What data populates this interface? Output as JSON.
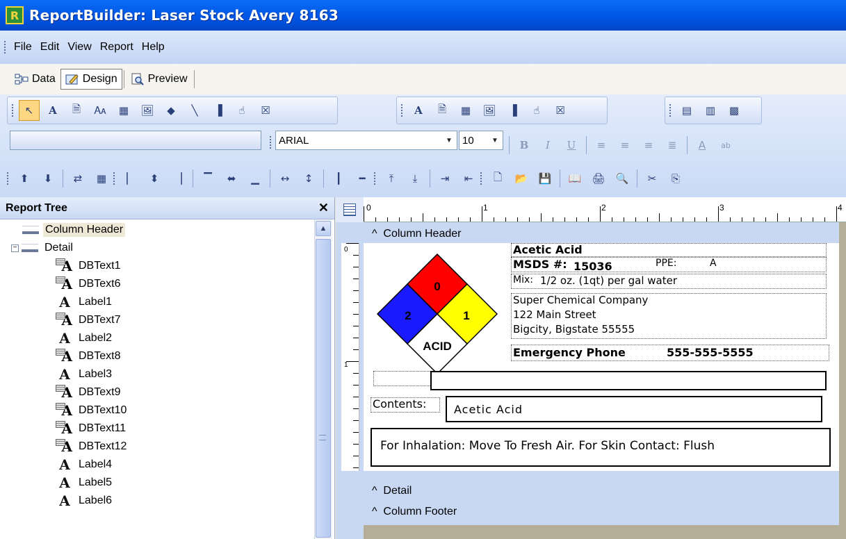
{
  "window": {
    "title": "ReportBuilder: Laser Stock Avery 8163",
    "icon": "R"
  },
  "menu": [
    "File",
    "Edit",
    "View",
    "Report",
    "Help"
  ],
  "tabs": [
    {
      "label": "Data",
      "icon": "data-tree-icon",
      "active": false
    },
    {
      "label": "Design",
      "icon": "design-pencil-icon",
      "active": true
    },
    {
      "label": "Preview",
      "icon": "preview-magnifier-icon",
      "active": false
    }
  ],
  "format_toolbar": {
    "font_name": "ARIAL",
    "font_size": "10"
  },
  "report_tree": {
    "title": "Report Tree",
    "items": [
      {
        "label": "Column Header",
        "type": "band",
        "level": 0
      },
      {
        "label": "Detail",
        "type": "band",
        "level": 0,
        "expanded": true
      },
      {
        "label": "DBText1",
        "type": "dbtext",
        "level": 1
      },
      {
        "label": "DBText6",
        "type": "dbtext",
        "level": 1
      },
      {
        "label": "Label1",
        "type": "label",
        "level": 1
      },
      {
        "label": "DBText7",
        "type": "dbtext",
        "level": 1
      },
      {
        "label": "Label2",
        "type": "label",
        "level": 1
      },
      {
        "label": "DBText8",
        "type": "dbtext",
        "level": 1
      },
      {
        "label": "Label3",
        "type": "label",
        "level": 1
      },
      {
        "label": "DBText9",
        "type": "dbtext",
        "level": 1
      },
      {
        "label": "DBText10",
        "type": "dbtext",
        "level": 1
      },
      {
        "label": "DBText11",
        "type": "dbtext",
        "level": 1
      },
      {
        "label": "DBText12",
        "type": "dbtext",
        "level": 1
      },
      {
        "label": "Label4",
        "type": "label",
        "level": 1
      },
      {
        "label": "Label5",
        "type": "label",
        "level": 1
      },
      {
        "label": "Label6",
        "type": "label",
        "level": 1
      }
    ]
  },
  "ruler": {
    "top_numbers": [
      "0",
      "1",
      "2",
      "3",
      "4"
    ],
    "left_numbers": [
      "0",
      "1"
    ]
  },
  "bands": {
    "column_header": "Column Header",
    "detail": "Detail",
    "column_footer": "Column Footer"
  },
  "label": {
    "chemical": "Acetic Acid",
    "msds_label": "MSDS #:",
    "msds_number": "15036",
    "ppe_label": "PPE:",
    "ppe_value": "A",
    "mix_label": "Mix:",
    "mix_value": "1/2 oz. (1qt) per gal water",
    "company": "Super Chemical Company",
    "street": "122 Main Street",
    "city": "Bigcity, Bigstate 55555",
    "emergency_label": "Emergency Phone",
    "emergency_phone": "555-555-5555",
    "contents_label": "Contents:",
    "contents_value": "Acetic Acid",
    "instructions": "For Inhalation: Move To Fresh Air. For Skin Contact: Flush"
  },
  "nfpa": {
    "health": "2",
    "fire": "0",
    "reactivity": "1",
    "special": "ACID",
    "colors": {
      "health": "#1a1aff",
      "fire": "#ff0000",
      "reactivity": "#ffff00",
      "special": "#ffffff"
    }
  }
}
